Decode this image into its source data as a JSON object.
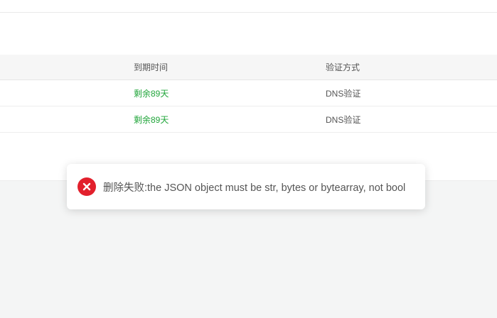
{
  "table": {
    "headers": {
      "expire": "到期时间",
      "verify": "验证方式"
    },
    "rows": [
      {
        "expire": "剩余89天",
        "verify": "DNS验证"
      },
      {
        "expire": "剩余89天",
        "verify": "DNS验证"
      }
    ]
  },
  "toast": {
    "icon": "error-icon",
    "message": "删除失败:the JSON object must be str, bytes or bytearray, not bool"
  },
  "colors": {
    "expire_text": "#20a53a",
    "error_icon": "#e2202c"
  }
}
